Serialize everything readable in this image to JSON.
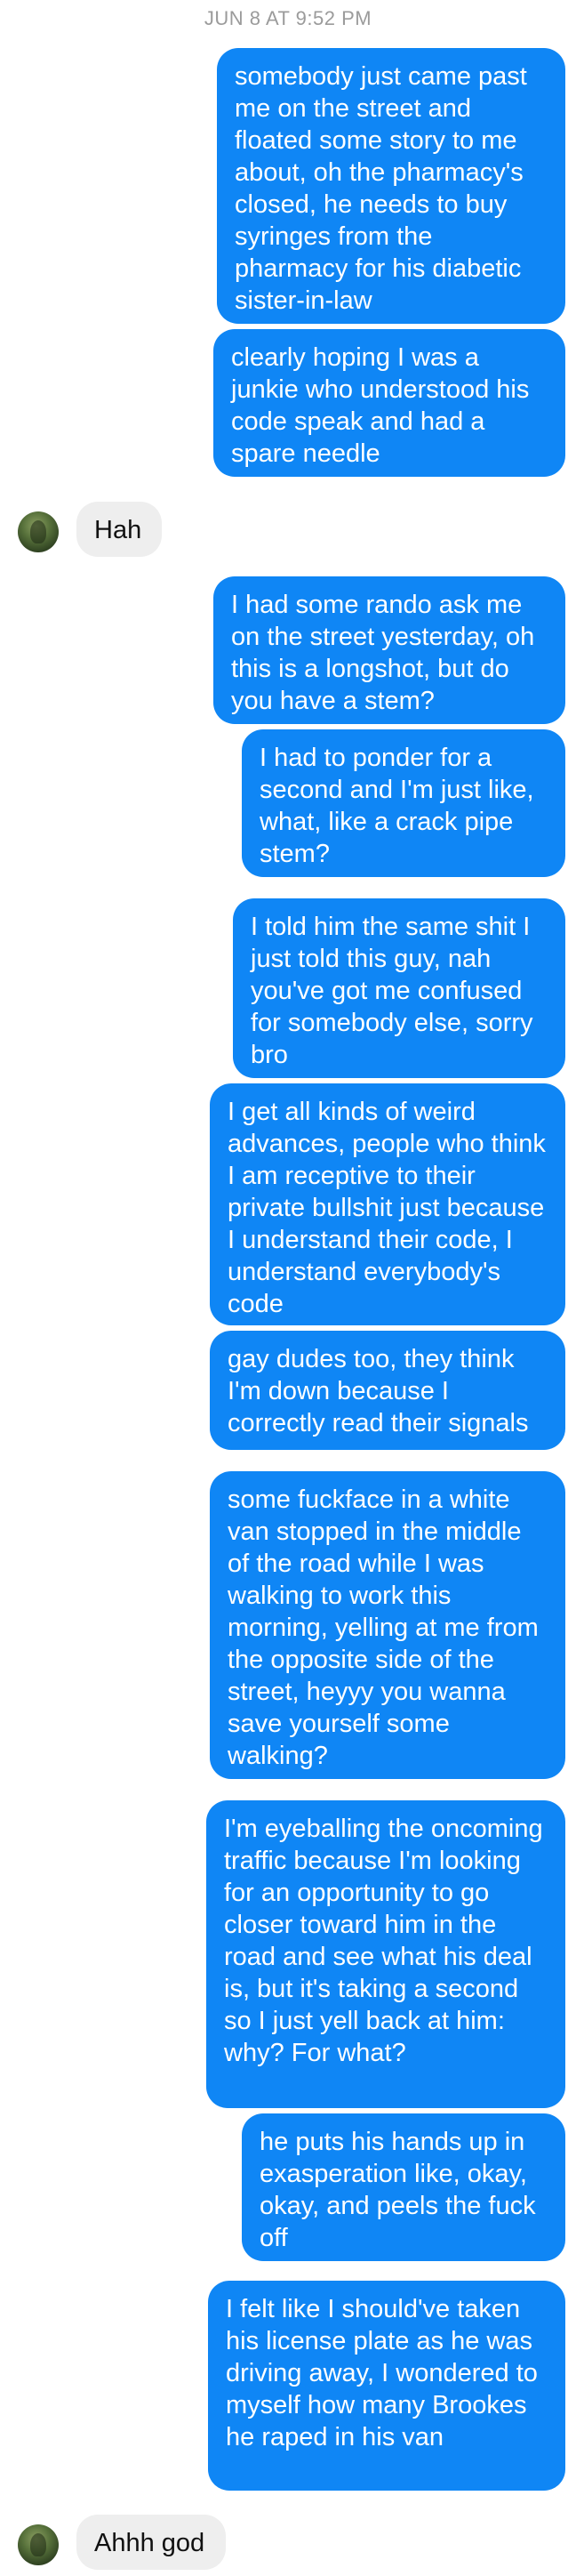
{
  "conversation": {
    "timestamp": "JUN 8 AT 9:52 PM",
    "messages": [
      {
        "from": "me",
        "text": "somebody just came past me on the street and floated some story to me about, oh the pharmacy's closed, he needs to buy syringes from the pharmacy for his diabetic sister-in-law"
      },
      {
        "from": "me",
        "text": "clearly hoping I was a junkie who understood his code speak and had a spare needle"
      },
      {
        "from": "them",
        "text": "Hah"
      },
      {
        "from": "me",
        "text": "I had some rando ask me on the street yesterday, oh this is a longshot, but do you have a stem?"
      },
      {
        "from": "me",
        "text": "I had to ponder for a second and I'm just like, what, like a crack pipe stem?"
      },
      {
        "from": "me",
        "text": "I told him the same shit I just told this guy, nah you've got me confused for somebody else, sorry bro"
      },
      {
        "from": "me",
        "text": "I get all kinds of weird advances, people who think I am receptive to their private bullshit just because I understand their code, I understand everybody's code"
      },
      {
        "from": "me",
        "text": "gay dudes too, they think I'm down because I correctly read their signals"
      },
      {
        "from": "me",
        "text": "some fuckface in a white van stopped in the middle of the road while I was walking to work this morning, yelling at me from the opposite side of the street, heyyy you wanna save yourself some walking?"
      },
      {
        "from": "me",
        "text": "I'm eyeballing the oncoming traffic because I'm looking for an opportunity to go closer toward him in the road and see what his deal is, but it's taking a second so I just yell back at him: why? For what?"
      },
      {
        "from": "me",
        "text": "he puts his hands up in exasperation like, okay, okay, and peels the fuck off"
      },
      {
        "from": "me",
        "text": "I felt like I should've taken his license plate as he was driving away, I wondered to myself how many Brookes he raped in his van"
      },
      {
        "from": "them",
        "text": "Ahhh god"
      }
    ]
  },
  "colors": {
    "sent_bubble": "#0f86f5",
    "received_bubble": "#eeeeee",
    "timestamp": "#9b9b9b"
  }
}
